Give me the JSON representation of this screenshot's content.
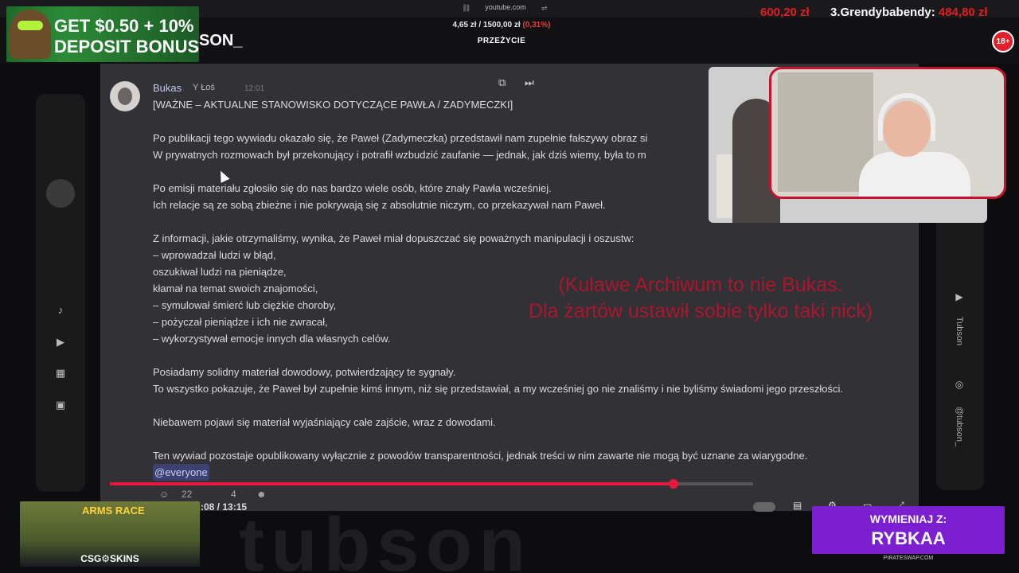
{
  "browser": {
    "url": "youtube.com"
  },
  "stream": {
    "balance_value": "4,65 zł",
    "balance_sep": "/",
    "balance_target": "1500,00 zł",
    "balance_percent": "(0,31%)",
    "status_title": "PRZEŻYCIE",
    "top_amount": "600,20 zł",
    "top_rank_label": "3.Grendybabendy:",
    "top_rank_amount": "484,80 zł",
    "age_badge": "18+",
    "channel_tag": "SON_"
  },
  "promo": {
    "line1": "GET $0.50 + 10%",
    "line2": "DEPOSIT BONUS"
  },
  "message": {
    "author": "Bukas",
    "role": "Y Łoś",
    "time": "12:01",
    "lines": [
      "[WAŻNE – AKTUALNE STANOWISKO DOTYCZĄCE PAWŁA / ZADYMECZKI]",
      "",
      "Po publikacji tego wywiadu okazało się, że Paweł (Zadymeczka) przedstawił nam zupełnie fałszywy obraz si",
      "W prywatnych rozmowach był przekonujący i potrafił wzbudzić zaufanie — jednak, jak dziś wiemy, była to m",
      "",
      "Po emisji materiału zgłosiło się do nas bardzo wiele osób, które znały Pawła wcześniej.",
      "Ich relacje są ze sobą zbieżne i nie pokrywają się z absolutnie niczym, co przekazywał nam Paweł.",
      "",
      "Z informacji, jakie otrzymaliśmy, wynika, że Paweł miał dopuszczać się poważnych manipulacji i oszustw:",
      "– wprowadzał ludzi w błąd,",
      "oszukiwał ludzi na pieniądze,",
      "kłamał na temat swoich znajomości,",
      "– symulował śmierć lub ciężkie choroby,",
      "– pożyczał pieniądze i ich nie zwracał,",
      "– wykorzystywał emocje innych dla własnych celów.",
      "",
      "Posiadamy solidny materiał dowodowy, potwierdzający te sygnały.",
      "To wszystko pokazuje, że Paweł był zupełnie kimś innym, niż się przedstawiał, a my wcześniej go nie znaliśmy i nie byliśmy świadomi jego przeszłości.",
      "",
      "Niebawem pojawi się materiał wyjaśniający całe zajście, wraz z dowodami.",
      "",
      "Ten wywiad pozostaje opublikowany wyłącznie z powodów transparentności, jednak treści w nim zawarte nie mogą być uznane za wiarygodne."
    ],
    "mention": "@everyone"
  },
  "overlay": {
    "line1": "(Kulawe Archiwum to nie Bukas.",
    "line2": "Dla żartów ustawił sobie tylko taki nick)"
  },
  "video": {
    "progress": 0.876,
    "timecode": ":08 / 13:15",
    "reaction_count_1": "22",
    "reaction_count_2": "4"
  },
  "right_sidebar": {
    "name": "Tubson",
    "handle": "@tubson_"
  },
  "watermark": "tubson",
  "ad_left": {
    "game": "ARMS RACE",
    "brand": "CSG⚙SKINS"
  },
  "ad_right": {
    "line1": "WYMIENIAJ Z:",
    "line2": "RYBKAA",
    "site": "PIRATESWAP.COM"
  },
  "colors": {
    "accent_red": "#e01e1e",
    "panel_bg": "#313136",
    "progress": "#e8173d",
    "ad_purple": "#7b1fd1"
  }
}
